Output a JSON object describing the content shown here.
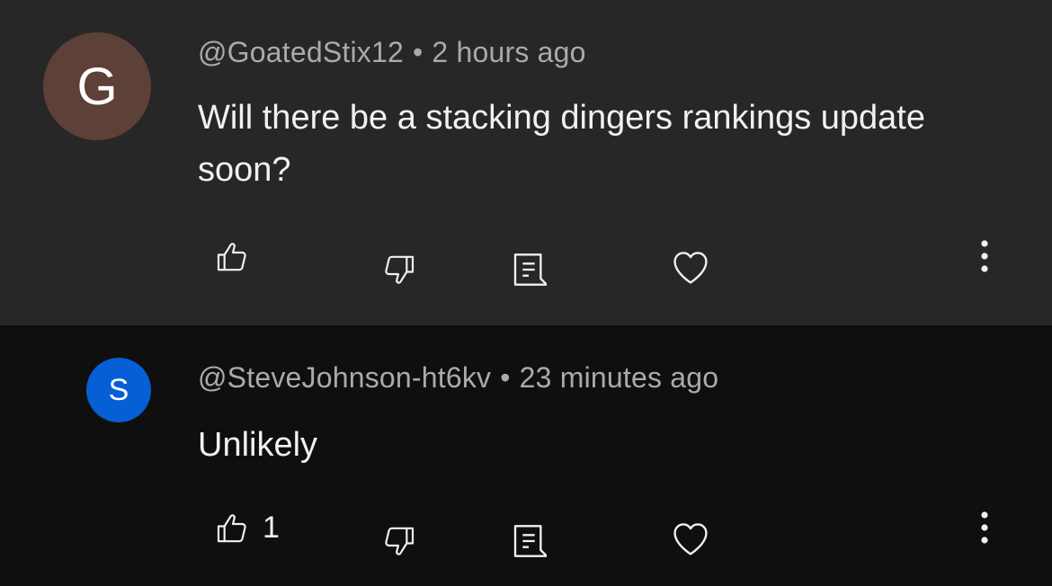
{
  "comments": [
    {
      "avatar_letter": "G",
      "avatar_color": "#5d4037",
      "author": "@GoatedStix12",
      "separator": "•",
      "time": "2 hours ago",
      "text": "Will there be a stacking dingers rankings update soon?",
      "like_count": ""
    },
    {
      "avatar_letter": "S",
      "avatar_color": "#065fd4",
      "author": "@SteveJohnson-ht6kv",
      "separator": "•",
      "time": "23 minutes ago",
      "text": "Unlikely",
      "like_count": "1"
    }
  ],
  "icons": {
    "like": "thumbs-up-icon",
    "dislike": "thumbs-down-icon",
    "reply": "reply-comment-icon",
    "heart": "heart-icon",
    "more": "more-vertical-icon"
  }
}
